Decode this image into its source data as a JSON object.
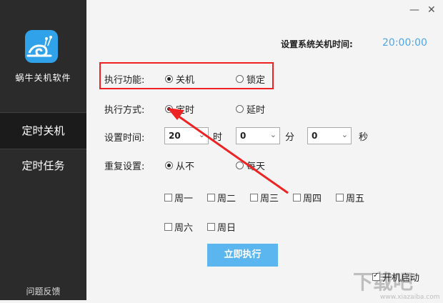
{
  "sidebar": {
    "app_name": "蜗牛关机软件",
    "items": [
      {
        "label": "定时关机"
      },
      {
        "label": "定时任务"
      }
    ],
    "feedback": "问题反馈"
  },
  "window": {
    "minimize": "—",
    "close": "✕"
  },
  "system_time": {
    "label": "设置系统关机时间:",
    "value": "20:00:00"
  },
  "function": {
    "label": "执行功能:",
    "options": [
      {
        "label": "关机",
        "selected": true
      },
      {
        "label": "锁定",
        "selected": false
      }
    ]
  },
  "mode": {
    "label": "执行方式:",
    "options": [
      {
        "label": "定时",
        "selected": true
      },
      {
        "label": "延时",
        "selected": false
      }
    ]
  },
  "time_setting": {
    "label": "设置时间:",
    "hour": "20",
    "hour_unit": "时",
    "minute": "0",
    "minute_unit": "分",
    "second": "0",
    "second_unit": "秒"
  },
  "repeat": {
    "label": "重复设置:",
    "options": [
      {
        "label": "从不",
        "selected": true
      },
      {
        "label": "每天",
        "selected": false
      }
    ],
    "days": [
      "周一",
      "周二",
      "周三",
      "周四",
      "周五",
      "周六",
      "周日"
    ]
  },
  "execute_button": "立即执行",
  "autostart": {
    "label": "开机启动",
    "checked": true
  },
  "colors": {
    "accent": "#4da6ea",
    "button": "#5bb6f0",
    "sidebar": "#2b2b2b",
    "annotation": "#e22222"
  },
  "watermark": "下载吧"
}
